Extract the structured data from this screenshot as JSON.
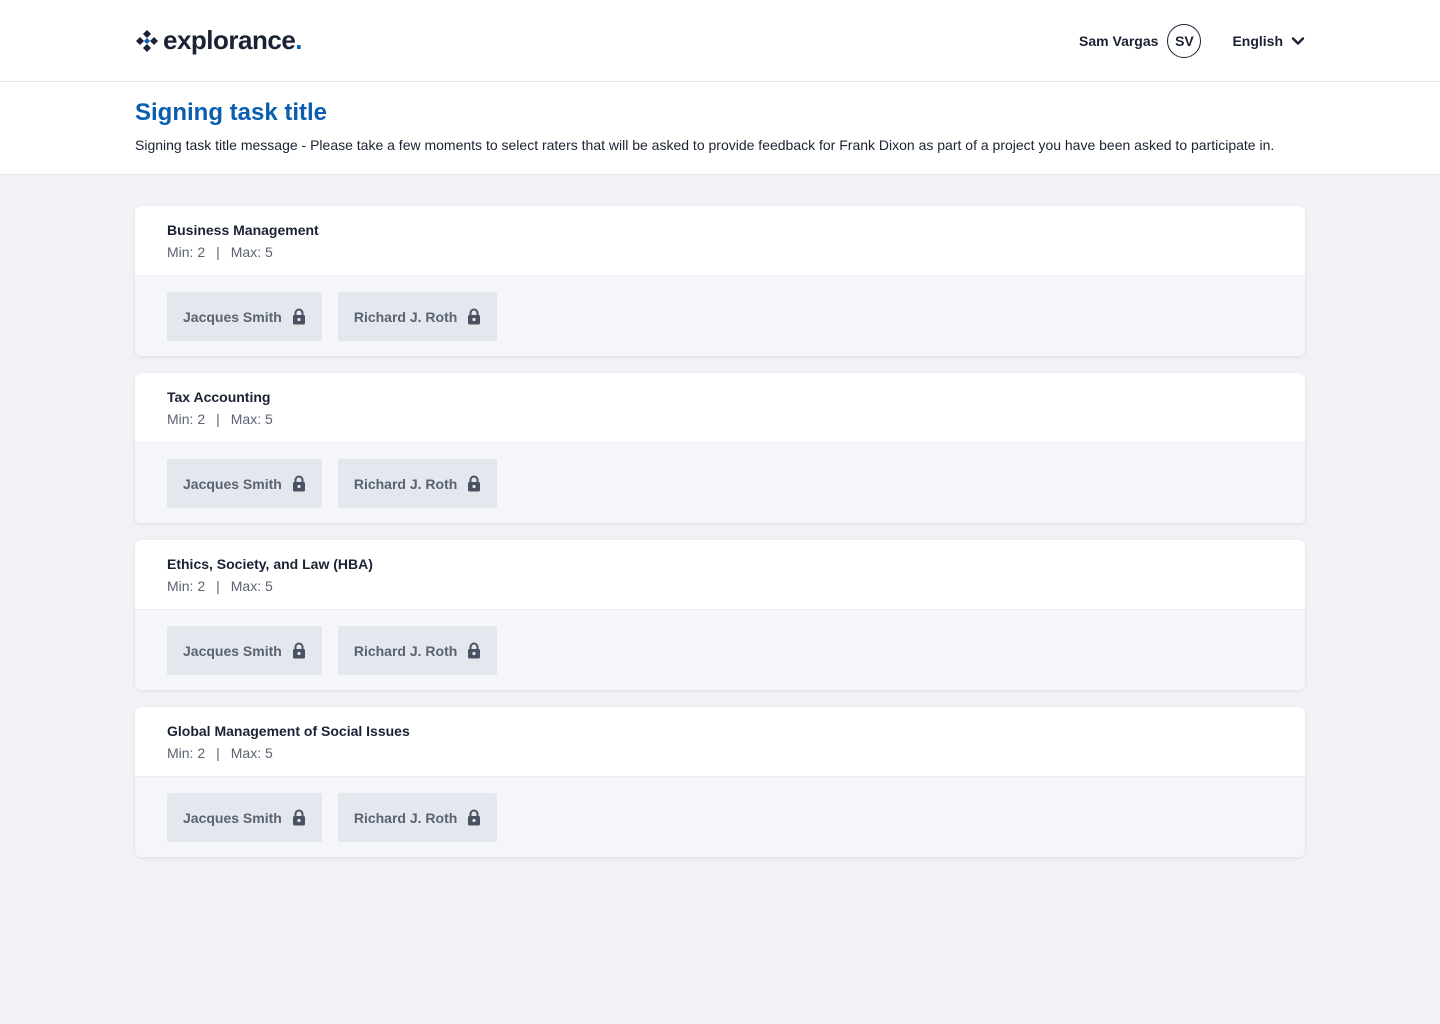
{
  "brand": {
    "name": "explorance",
    "dot": ".",
    "accent": "#0a5eb0"
  },
  "header": {
    "user_name": "Sam Vargas",
    "user_initials": "SV",
    "language": "English"
  },
  "page": {
    "title": "Signing task title",
    "message": "Signing task title message - Please take a few moments to select raters that will be asked to provide feedback for Frank Dixon as part of a project you have been asked to participate in."
  },
  "groups": [
    {
      "title": "Business Management",
      "min": "Min: 2",
      "sep": "|",
      "max": "Max: 5",
      "raters": [
        {
          "name": "Jacques Smith",
          "icon": "lock-icon"
        },
        {
          "name": "Richard J. Roth",
          "icon": "lock-icon"
        }
      ]
    },
    {
      "title": "Tax Accounting",
      "min": "Min: 2",
      "sep": "|",
      "max": "Max: 5",
      "raters": [
        {
          "name": "Jacques Smith",
          "icon": "lock-icon"
        },
        {
          "name": "Richard J. Roth",
          "icon": "lock-icon"
        }
      ]
    },
    {
      "title": "Ethics, Society, and Law (HBA)",
      "min": "Min: 2",
      "sep": "|",
      "max": "Max: 5",
      "raters": [
        {
          "name": "Jacques Smith",
          "icon": "lock-icon"
        },
        {
          "name": "Richard J. Roth",
          "icon": "lock-icon"
        }
      ]
    },
    {
      "title": "Global Management of Social Issues",
      "min": "Min: 2",
      "sep": "|",
      "max": "Max: 5",
      "raters": [
        {
          "name": "Jacques Smith",
          "icon": "lock-icon"
        },
        {
          "name": "Richard J. Roth",
          "icon": "lock-icon"
        }
      ]
    }
  ]
}
